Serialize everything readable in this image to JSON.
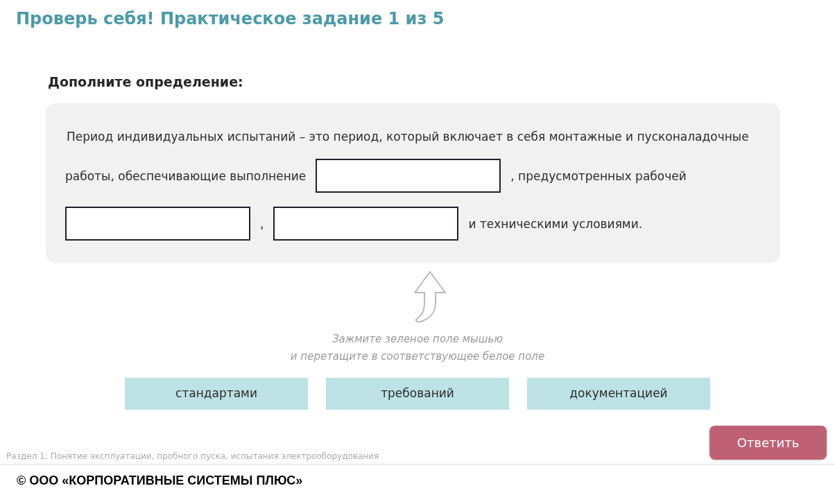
{
  "title": "Проверь себя! Практическое задание 1 из 5",
  "instruction": "Дополните определение:",
  "definition": {
    "lines": [
      {
        "parts": [
          {
            "kind": "text",
            "text": "Период индивидуальных испытаний – это период, который включает в себя монтажные и пусконаладочные"
          }
        ]
      },
      {
        "parts": [
          {
            "kind": "text",
            "text": "работы, обеспечивающие выполнение"
          },
          {
            "kind": "blank"
          },
          {
            "kind": "text",
            "text": ", предусмотренных рабочей"
          }
        ]
      },
      {
        "parts": [
          {
            "kind": "blank"
          },
          {
            "kind": "text",
            "text": ","
          },
          {
            "kind": "blank"
          },
          {
            "kind": "text",
            "text": "и техническими условиями."
          }
        ]
      }
    ]
  },
  "hint": "Зажмите зеленое поле мышью\nи перетащите в соответствующее белое поле",
  "options": [
    "стандартами",
    "требований",
    "документацией"
  ],
  "section": "Раздел 1: Понятие эксплуатации, пробного пуска, испытания электрооборудования",
  "answer_button": "Ответить",
  "copyright": "© ООО «КОРПОРАТИВНЫЕ СИСТЕМЫ ПЛЮС»"
}
